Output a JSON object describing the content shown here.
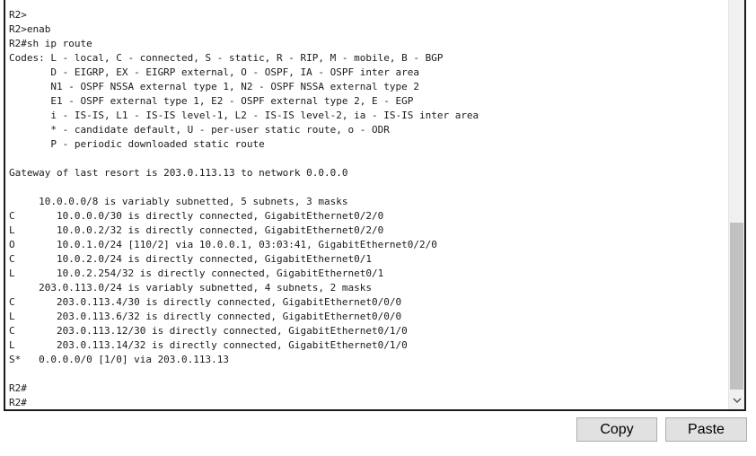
{
  "terminal": {
    "lines": [
      "R2>",
      "R2>enab",
      "R2#sh ip route",
      "Codes: L - local, C - connected, S - static, R - RIP, M - mobile, B - BGP",
      "       D - EIGRP, EX - EIGRP external, O - OSPF, IA - OSPF inter area",
      "       N1 - OSPF NSSA external type 1, N2 - OSPF NSSA external type 2",
      "       E1 - OSPF external type 1, E2 - OSPF external type 2, E - EGP",
      "       i - IS-IS, L1 - IS-IS level-1, L2 - IS-IS level-2, ia - IS-IS inter area",
      "       * - candidate default, U - per-user static route, o - ODR",
      "       P - periodic downloaded static route",
      "",
      "Gateway of last resort is 203.0.113.13 to network 0.0.0.0",
      "",
      "     10.0.0.0/8 is variably subnetted, 5 subnets, 3 masks",
      "C       10.0.0.0/30 is directly connected, GigabitEthernet0/2/0",
      "L       10.0.0.2/32 is directly connected, GigabitEthernet0/2/0",
      "O       10.0.1.0/24 [110/2] via 10.0.0.1, 03:03:41, GigabitEthernet0/2/0",
      "C       10.0.2.0/24 is directly connected, GigabitEthernet0/1",
      "L       10.0.2.254/32 is directly connected, GigabitEthernet0/1",
      "     203.0.113.0/24 is variably subnetted, 4 subnets, 2 masks",
      "C       203.0.113.4/30 is directly connected, GigabitEthernet0/0/0",
      "L       203.0.113.6/32 is directly connected, GigabitEthernet0/0/0",
      "C       203.0.113.12/30 is directly connected, GigabitEthernet0/1/0",
      "L       203.0.113.14/32 is directly connected, GigabitEthernet0/1/0",
      "S*   0.0.0.0/0 [1/0] via 203.0.113.13",
      "",
      "R2#",
      "R2#"
    ],
    "scroll_down_icon": "chevron-down-icon"
  },
  "buttons": {
    "copy_label": "Copy",
    "paste_label": "Paste"
  }
}
